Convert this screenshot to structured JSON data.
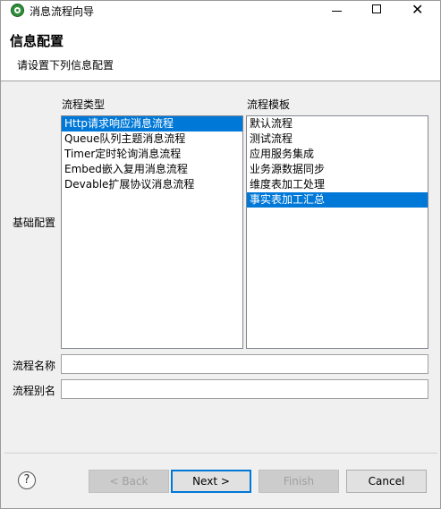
{
  "window": {
    "title": "消息流程向导",
    "minimize_symbol": "",
    "close_symbol": "✕"
  },
  "banner": {
    "title": "信息配置",
    "subtitle": "请设置下列信息配置"
  },
  "form": {
    "basic_config_label": "基础配置",
    "flow_type": {
      "label": "流程类型",
      "items": [
        {
          "label": "Http请求响应消息流程",
          "selected": true
        },
        {
          "label": "Queue队列主题消息流程",
          "selected": false
        },
        {
          "label": "Timer定时轮询消息流程",
          "selected": false
        },
        {
          "label": "Embed嵌入复用消息流程",
          "selected": false
        },
        {
          "label": "Devable扩展协议消息流程",
          "selected": false
        }
      ]
    },
    "flow_template": {
      "label": "流程模板",
      "items": [
        {
          "label": "默认流程",
          "selected": false
        },
        {
          "label": "测试流程",
          "selected": false
        },
        {
          "label": "应用服务集成",
          "selected": false
        },
        {
          "label": "业务源数据同步",
          "selected": false
        },
        {
          "label": "维度表加工处理",
          "selected": false
        },
        {
          "label": "事实表加工汇总",
          "selected": true
        }
      ]
    },
    "flow_name": {
      "label": "流程名称",
      "value": ""
    },
    "flow_alias": {
      "label": "流程别名",
      "value": ""
    }
  },
  "footer": {
    "help_symbol": "?",
    "back_label": "< Back",
    "next_label": "Next >",
    "finish_label": "Finish",
    "cancel_label": "Cancel"
  },
  "colors": {
    "selection": "#0078d7",
    "default_button_border": "#0078d7"
  }
}
